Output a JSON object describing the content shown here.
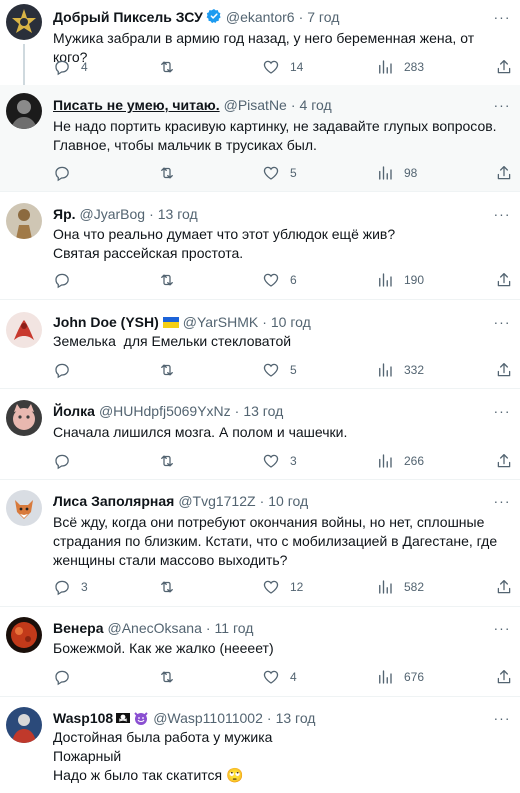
{
  "tweets": [
    {
      "name": "Добрый Пиксель ЗСУ",
      "handle": "@ekantor6",
      "time": "7 год",
      "verified": true,
      "text": [
        "Мужика забрали в армию год назад, у него беременная жена, от кого?"
      ],
      "replies": "4",
      "retweets": "",
      "likes": "14",
      "views": "283",
      "avatar_colors": [
        "#2a2f3a",
        "#d9b445"
      ]
    },
    {
      "name": "Писать не умею, читаю.",
      "handle": "@PisatNe",
      "time": "4 год",
      "text": [
        "Не надо портить красивую картинку, не задавайте глупых вопросов.",
        "Главное, чтобы мальчик в трусиках был."
      ],
      "replies": "",
      "retweets": "",
      "likes": "5",
      "views": "98",
      "avatar_colors": [
        "#1b1b1b",
        "#8a8a8a"
      ]
    },
    {
      "name": "Яр.",
      "handle": "@JyarBog",
      "time": "13 год",
      "text": [
        "Она что реально думает что этот ублюдок ещё жив?",
        "Святая рассейская простота."
      ],
      "replies": "",
      "retweets": "",
      "likes": "6",
      "views": "190",
      "avatar_colors": [
        "#cfc6b4",
        "#8c6a3f"
      ]
    },
    {
      "name": "John Doe (YSH)",
      "handle": "@YarSHMK",
      "time": "10 год",
      "text": [
        "Земелька  для Емельки стекловатой"
      ],
      "replies": "",
      "retweets": "",
      "likes": "5",
      "views": "332",
      "avatar_colors": [
        "#f2e4e1",
        "#c8392e"
      ]
    },
    {
      "name": "Йолка",
      "handle": "@HUHdpfj5069YxNz",
      "time": "13 год",
      "text": [
        "Сначала лишился мозга. А полом и чашечки."
      ],
      "replies": "",
      "retweets": "",
      "likes": "3",
      "views": "266",
      "avatar_colors": [
        "#3c3c3c",
        "#e8b8b0"
      ]
    },
    {
      "name": "Лиса Заполярная",
      "handle": "@Tvg1712Z",
      "time": "10 год",
      "text": [
        "Всё жду, когда они потребуют окончания войны, но нет, сплошные",
        "страдания по близким. Кстати, что с мобилизацией в Дагестане, где",
        "женщины стали массово выходить?"
      ],
      "replies": "3",
      "retweets": "",
      "likes": "12",
      "views": "582",
      "avatar_colors": [
        "#d9dde3",
        "#d87a3c"
      ]
    },
    {
      "name": "Венера",
      "handle": "@AnecOksana",
      "time": "11 год",
      "text": [
        "Божежмой. Как же жалко (нееeет)"
      ],
      "replies": "",
      "retweets": "",
      "likes": "4",
      "views": "676",
      "avatar_colors": [
        "#1a0f0a",
        "#c23a1a"
      ]
    },
    {
      "name": "Wasp108",
      "handle": "@Wasp11011002",
      "time": "13 год",
      "text": [
        "Достойная была работа у мужика",
        "Пожарный",
        "Надо ж было так скатится 🙄"
      ],
      "replies": "",
      "retweets": "",
      "likes": "",
      "views": "",
      "avatar_colors": [
        "#2b4a7a",
        "#d8d8d8"
      ]
    }
  ],
  "icons": {
    "reply": "reply-icon",
    "retweet": "retweet-icon",
    "like": "heart-icon",
    "views": "views-icon",
    "share": "share-icon",
    "more": "more-icon",
    "verified": "verified-badge-icon"
  },
  "colors": {
    "text": "#0f1419",
    "secondary": "#536471",
    "border": "#eff3f4",
    "verified": "#1d9bf0",
    "highlight_bg": "#f7f9f9"
  }
}
